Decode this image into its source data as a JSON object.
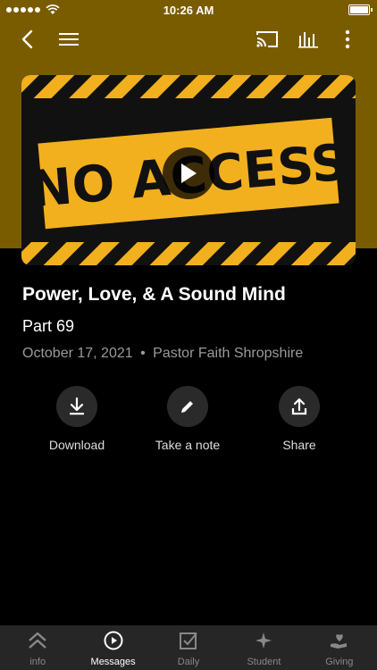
{
  "status_bar": {
    "time": "10:26 AM"
  },
  "nav": {
    "back_icon": "chevron-left-icon",
    "menu_icon": "hamburger-icon",
    "cast_icon": "cast-icon",
    "audio_icon": "audio-bars-icon",
    "more_icon": "more-vertical-icon"
  },
  "thumbnail": {
    "banner_text": "NO ACCESS",
    "play_icon": "play-icon",
    "colors": {
      "stripe_yellow": "#f2b01e",
      "background": "#111111"
    }
  },
  "message": {
    "title": "Power, Love, & A Sound Mind",
    "part": "Part 69",
    "date": "October 17, 2021",
    "separator": "•",
    "speaker": "Pastor Faith Shropshire"
  },
  "actions": [
    {
      "label": "Download",
      "icon": "download-icon"
    },
    {
      "label": "Take a note",
      "icon": "pencil-icon"
    },
    {
      "label": "Share",
      "icon": "share-icon"
    }
  ],
  "tabs": [
    {
      "label": "info",
      "icon": "chevrons-up-icon"
    },
    {
      "label": "Messages",
      "icon": "play-circle-icon",
      "active": true
    },
    {
      "label": "Daily",
      "icon": "checkbox-icon"
    },
    {
      "label": "Student",
      "icon": "sparkle-icon"
    },
    {
      "label": "Giving",
      "icon": "heart-hand-icon"
    }
  ],
  "colors": {
    "header_bg": "#7a5c00",
    "tabbar_bg": "#262626",
    "muted_text": "#9a9a9a"
  }
}
